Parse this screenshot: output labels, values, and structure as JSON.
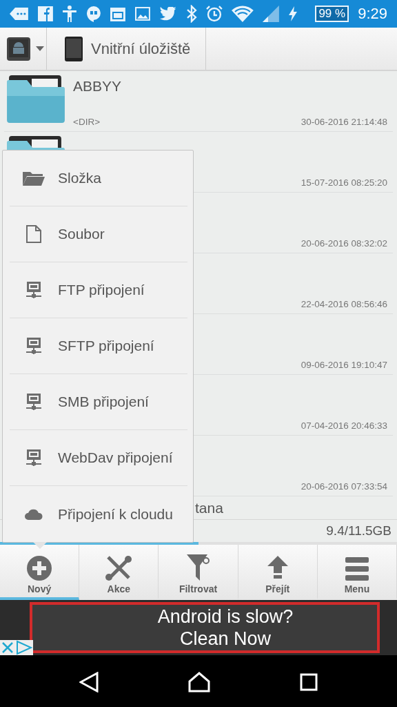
{
  "status_bar": {
    "battery": "99 %",
    "time": "9:29"
  },
  "breadcrumb": {
    "location": "Vnitřní úložiště"
  },
  "files": [
    {
      "kind": "folder",
      "name": "ABBYY",
      "size": "<DIR>",
      "date": "30-06-2016 21:14:48"
    },
    {
      "kind": "folder",
      "date": "15-07-2016 08:25:20"
    },
    {
      "kind": "covered",
      "date": "20-06-2016 08:32:02"
    },
    {
      "kind": "covered",
      "date": "22-04-2016 08:56:46"
    },
    {
      "kind": "covered",
      "date": "09-06-2016 19:10:47"
    },
    {
      "kind": "covered",
      "date": "07-04-2016 20:46:33"
    },
    {
      "kind": "covered",
      "date": "20-06-2016 07:33:54"
    },
    {
      "kind": "cut",
      "name": "tana"
    }
  ],
  "storage": {
    "text": "9.4/11.5GB",
    "level": 0.5
  },
  "new_menu": [
    {
      "kind": "folder",
      "label": "Složka"
    },
    {
      "kind": "file",
      "label": "Soubor"
    },
    {
      "kind": "server",
      "label": "FTP připojení"
    },
    {
      "kind": "server",
      "label": "SFTP připojení"
    },
    {
      "kind": "server",
      "label": "SMB připojení"
    },
    {
      "kind": "server",
      "label": "WebDav připojení"
    },
    {
      "kind": "cloud",
      "label": "Připojení k cloudu"
    }
  ],
  "toolbar": [
    {
      "kind": "plus",
      "label": "Nový",
      "selected": true
    },
    {
      "kind": "tools",
      "label": "Akce",
      "selected": false
    },
    {
      "kind": "filter",
      "label": "Filtrovat",
      "selected": false
    },
    {
      "kind": "up",
      "label": "Přejít",
      "selected": false
    },
    {
      "kind": "menu",
      "label": "Menu",
      "selected": false
    }
  ],
  "ad": {
    "line_1": "Android is slow?",
    "line_2": "Clean Now"
  }
}
